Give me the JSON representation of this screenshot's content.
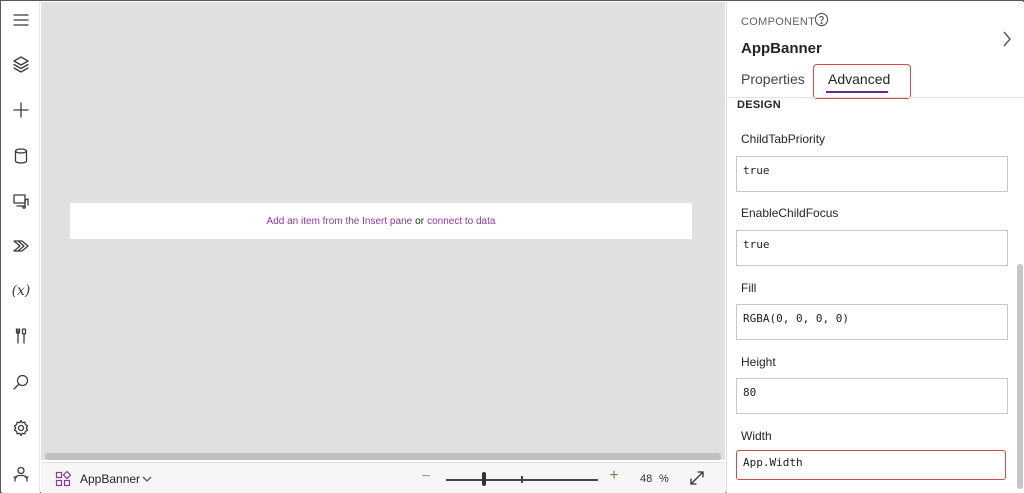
{
  "rail": {
    "items": [
      {
        "name": "menu-icon"
      },
      {
        "name": "tree-view-icon"
      },
      {
        "name": "insert-icon"
      },
      {
        "name": "data-icon"
      },
      {
        "name": "media-icon"
      },
      {
        "name": "power-automate-icon"
      },
      {
        "name": "variables-icon",
        "glyph": "(x)"
      },
      {
        "name": "advanced-tools-icon"
      },
      {
        "name": "search-icon"
      },
      {
        "name": "settings-icon"
      },
      {
        "name": "virtual-agent-icon"
      }
    ]
  },
  "canvas": {
    "banner": {
      "link1": "Add an item from the Insert pane",
      "or": "or",
      "link2": "connect to data"
    }
  },
  "bottombar": {
    "component_name": "AppBanner",
    "zoom_minus": "−",
    "zoom_plus": "+",
    "zoom_value": "48",
    "zoom_unit": "%",
    "zoom_level": 0.48
  },
  "pane": {
    "kicker": "COMPONENT",
    "title": "AppBanner",
    "tabs": [
      {
        "label": "Properties",
        "active": false
      },
      {
        "label": "Advanced",
        "active": true
      }
    ],
    "section": "DESIGN",
    "fields": [
      {
        "label": "ChildTabPriority",
        "value": "true"
      },
      {
        "label": "EnableChildFocus",
        "value": "true"
      },
      {
        "label": "Fill",
        "value": "RGBA(0, 0, 0, 0)"
      },
      {
        "label": "Height",
        "value": "80"
      },
      {
        "label": "Width",
        "value": "App.Width"
      }
    ]
  },
  "colors": {
    "accent": "#6b2a8a",
    "link": "#8a3a9c",
    "highlight": "#d24a4a",
    "canvas": "#e0e0e0"
  }
}
